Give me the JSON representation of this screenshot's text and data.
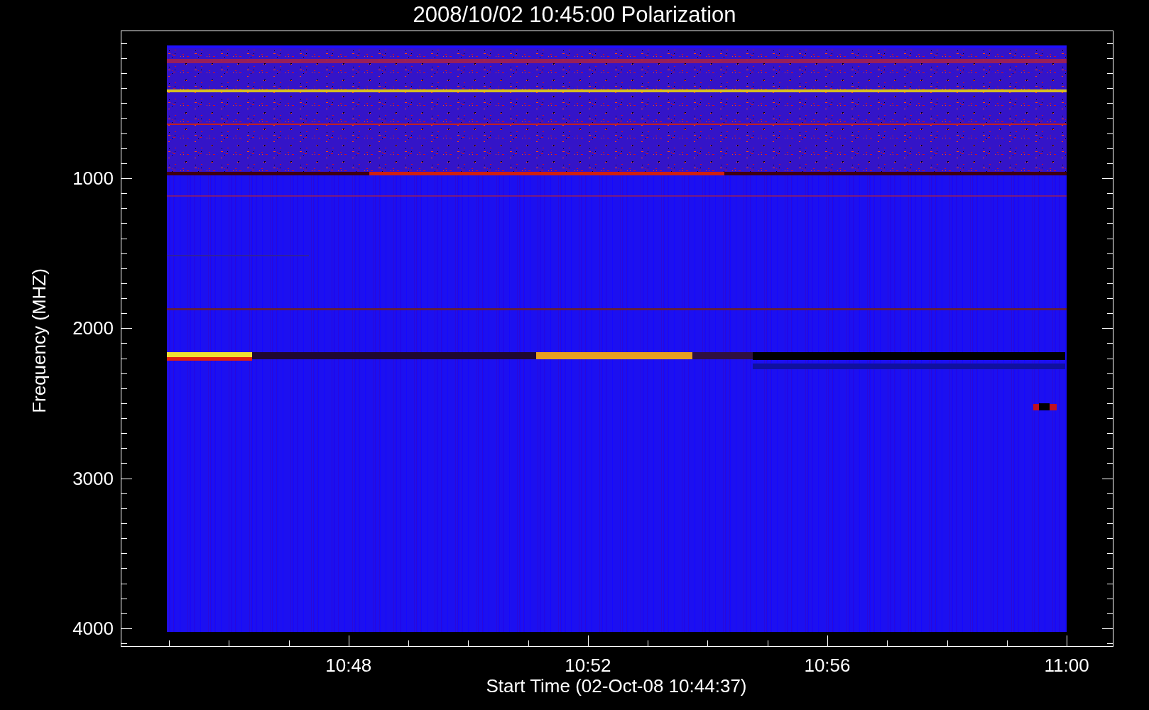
{
  "title": "2008/10/02 10:45:00 Polarization",
  "y_axis": {
    "label": "Frequency (MHZ)",
    "ticks": [
      "1000",
      "2000",
      "3000",
      "4000"
    ]
  },
  "x_axis": {
    "label": "Start Time (02-Oct-08 10:44:37)",
    "ticks": [
      "10:48",
      "10:52",
      "10:56",
      "11:00"
    ]
  }
}
